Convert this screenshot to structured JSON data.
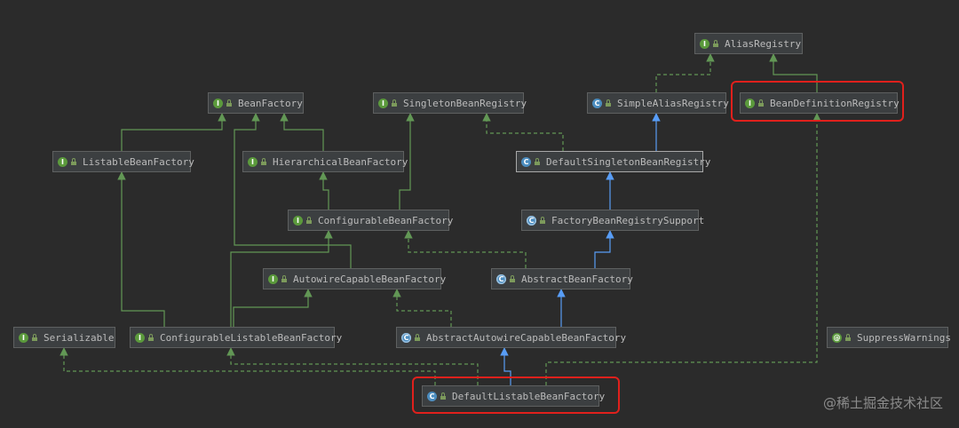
{
  "nodes": {
    "alias_registry": {
      "label": "AliasRegistry",
      "kind": "I"
    },
    "bean_factory": {
      "label": "BeanFactory",
      "kind": "I"
    },
    "singleton_bean_registry": {
      "label": "SingletonBeanRegistry",
      "kind": "I"
    },
    "simple_alias_registry": {
      "label": "SimpleAliasRegistry",
      "kind": "C"
    },
    "bean_definition_registry": {
      "label": "BeanDefinitionRegistry",
      "kind": "I"
    },
    "listable_bean_factory": {
      "label": "ListableBeanFactory",
      "kind": "I"
    },
    "hierarchical_bean_factory": {
      "label": "HierarchicalBeanFactory",
      "kind": "I"
    },
    "default_singleton_bean_registry": {
      "label": "DefaultSingletonBeanRegistry",
      "kind": "C"
    },
    "configurable_bean_factory": {
      "label": "ConfigurableBeanFactory",
      "kind": "I"
    },
    "factory_bean_registry_support": {
      "label": "FactoryBeanRegistrySupport",
      "kind": "C"
    },
    "autowire_capable_bean_factory": {
      "label": "AutowireCapableBeanFactory",
      "kind": "I"
    },
    "abstract_bean_factory": {
      "label": "AbstractBeanFactory",
      "kind": "C"
    },
    "serializable": {
      "label": "Serializable",
      "kind": "I"
    },
    "configurable_listable_bean_factory": {
      "label": "ConfigurableListableBeanFactory",
      "kind": "I"
    },
    "abstract_autowire_capable_bean_factory": {
      "label": "AbstractAutowireCapableBeanFactory",
      "kind": "C"
    },
    "suppress_warnings": {
      "label": "SuppressWarnings",
      "kind": "@"
    },
    "default_listable_bean_factory": {
      "label": "DefaultListableBeanFactory",
      "kind": "C"
    }
  },
  "colors": {
    "background": "#2b2b2b",
    "extends_interface": "#629755",
    "extends_class": "#589df6",
    "implements": "#629755",
    "highlight": "#e0201c"
  },
  "watermark": "@稀土掘金技术社区"
}
